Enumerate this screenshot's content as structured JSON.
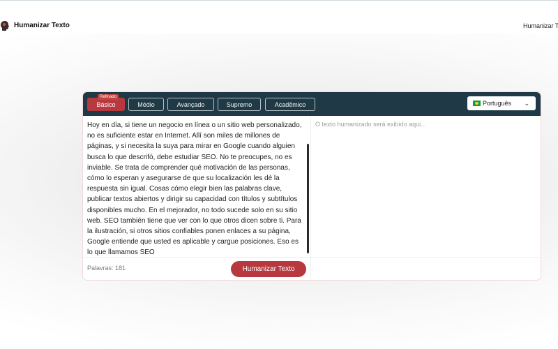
{
  "header": {
    "brand": "Humanizar Texto",
    "nav_link": "Humanizar Texto"
  },
  "tool": {
    "modes": [
      {
        "label": "Básico",
        "active": true,
        "badge": "Refinado"
      },
      {
        "label": "Médio",
        "active": false
      },
      {
        "label": "Avançado",
        "active": false
      },
      {
        "label": "Supremo",
        "active": false
      },
      {
        "label": "Acadêmico",
        "active": false
      }
    ],
    "language": "Português",
    "input_text": "Hoy en día, si tiene un negocio en línea o un sitio web personalizado, no es suficiente estar en Internet. Allí son miles de millones de páginas, y si necesita la suya para mirar en Google cuando alguien busca lo que descrifó, debe estudiar SEO. No te preocupes, no es inviable. Se trata de comprender qué motivación de las personas, cómo lo esperan y asegurarse de que su localización les dé la respuesta sin igual. Cosas cómo elegir bien las palabras clave, publicar textos abiertos y dirigir su capacidad con títulos y subtítulos disponibles mucho. En el mejorador, no todo sucede solo en su sitio web. SEO también tiene que ver con lo que otros dicen sobre ti. Para la ilustración, si otros sitios confiables ponen enlaces a su página, Google entiende que usted es aplicable y cargue posiciones. Eso es lo que llamamos SEO",
    "word_count": "Palavras: 181",
    "cta_label": "Humanizar Texto",
    "output_placeholder": "O texto humanizado será exibido aqui..."
  },
  "colors": {
    "toolbar": "#1f3a46",
    "accent": "#b8383f"
  }
}
